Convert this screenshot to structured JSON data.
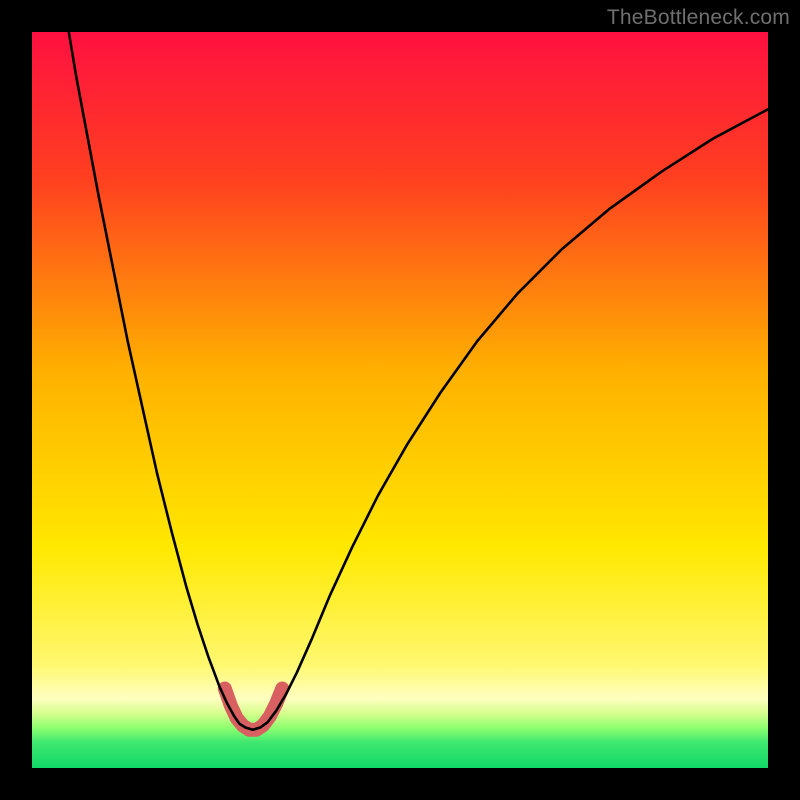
{
  "watermark": {
    "text": "TheBottleneck.com"
  },
  "chart_data": {
    "type": "line",
    "title": "",
    "xlabel": "",
    "ylabel": "",
    "xlim": [
      0,
      1
    ],
    "ylim": [
      0,
      1
    ],
    "background_gradient_stops": [
      {
        "pos": 0.0,
        "color": "#ff1040"
      },
      {
        "pos": 0.2,
        "color": "#ff4020"
      },
      {
        "pos": 0.46,
        "color": "#ffb000"
      },
      {
        "pos": 0.7,
        "color": "#ffe800"
      },
      {
        "pos": 0.86,
        "color": "#fff870"
      },
      {
        "pos": 0.905,
        "color": "#ffffc0"
      },
      {
        "pos": 0.925,
        "color": "#d8ff90"
      },
      {
        "pos": 0.945,
        "color": "#90ff70"
      },
      {
        "pos": 0.965,
        "color": "#40e870"
      },
      {
        "pos": 1.0,
        "color": "#10d868"
      }
    ],
    "series": [
      {
        "name": "v-curve",
        "stroke": "#000000",
        "stroke_width": 2.6,
        "points": [
          [
            0.05,
            1.0
          ],
          [
            0.06,
            0.94
          ],
          [
            0.075,
            0.86
          ],
          [
            0.09,
            0.78
          ],
          [
            0.11,
            0.68
          ],
          [
            0.13,
            0.58
          ],
          [
            0.15,
            0.49
          ],
          [
            0.17,
            0.4
          ],
          [
            0.19,
            0.32
          ],
          [
            0.21,
            0.245
          ],
          [
            0.225,
            0.195
          ],
          [
            0.24,
            0.15
          ],
          [
            0.255,
            0.11
          ],
          [
            0.265,
            0.088
          ],
          [
            0.275,
            0.07
          ],
          [
            0.282,
            0.06
          ],
          [
            0.29,
            0.055
          ],
          [
            0.3,
            0.052
          ],
          [
            0.31,
            0.055
          ],
          [
            0.32,
            0.062
          ],
          [
            0.332,
            0.078
          ],
          [
            0.345,
            0.1
          ],
          [
            0.36,
            0.13
          ],
          [
            0.38,
            0.175
          ],
          [
            0.405,
            0.235
          ],
          [
            0.435,
            0.3
          ],
          [
            0.47,
            0.37
          ],
          [
            0.51,
            0.44
          ],
          [
            0.555,
            0.51
          ],
          [
            0.605,
            0.58
          ],
          [
            0.66,
            0.645
          ],
          [
            0.72,
            0.705
          ],
          [
            0.785,
            0.76
          ],
          [
            0.855,
            0.81
          ],
          [
            0.925,
            0.855
          ],
          [
            1.0,
            0.895
          ]
        ]
      },
      {
        "name": "valley-highlight",
        "stroke": "#d86060",
        "stroke_width": 14,
        "linecap": "round",
        "points": [
          [
            0.262,
            0.108
          ],
          [
            0.27,
            0.085
          ],
          [
            0.278,
            0.068
          ],
          [
            0.286,
            0.058
          ],
          [
            0.295,
            0.052
          ],
          [
            0.305,
            0.052
          ],
          [
            0.314,
            0.058
          ],
          [
            0.323,
            0.07
          ],
          [
            0.332,
            0.088
          ],
          [
            0.34,
            0.108
          ]
        ]
      }
    ]
  }
}
